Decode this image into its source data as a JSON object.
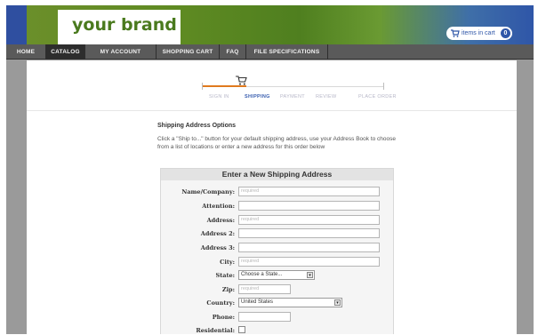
{
  "header": {
    "brand": "your brand",
    "cart_label": "items in cart",
    "cart_count": "0"
  },
  "nav": {
    "items": [
      {
        "label": "HOME",
        "active": false
      },
      {
        "label": "CATALOG",
        "active": true
      },
      {
        "label": "MY ACCOUNT",
        "active": false
      },
      {
        "label": "SHOPPING CART",
        "active": false
      },
      {
        "label": "FAQ",
        "active": false
      },
      {
        "label": "FILE SPECIFICATIONS",
        "active": false
      }
    ]
  },
  "checkout_steps": {
    "steps": [
      "SIGN IN",
      "SHIPPING",
      "PAYMENT",
      "REVIEW",
      "PLACE ORDER"
    ],
    "current": "SHIPPING"
  },
  "shipping": {
    "title": "Shipping Address Options",
    "help": "Click a \"Ship to...\" button for your default shipping address, use your Address Book to choose from a list of locations or enter a new address for this order below"
  },
  "form": {
    "title": "Enter a New Shipping Address",
    "fields": {
      "name_company": {
        "label": "Name/Company:",
        "placeholder": "required"
      },
      "attention": {
        "label": "Attention:",
        "placeholder": ""
      },
      "address": {
        "label": "Address:",
        "placeholder": "required"
      },
      "address2": {
        "label": "Address 2:",
        "placeholder": ""
      },
      "address3": {
        "label": "Address 3:",
        "placeholder": ""
      },
      "city": {
        "label": "City:",
        "placeholder": "required"
      },
      "state": {
        "label": "State:",
        "value": "Choose a State..."
      },
      "zip": {
        "label": "Zip:",
        "placeholder": "required"
      },
      "country": {
        "label": "Country:",
        "value": "United States"
      },
      "phone": {
        "label": "Phone:",
        "placeholder": ""
      },
      "residential": {
        "label": "Residential:",
        "checked": false
      }
    }
  }
}
